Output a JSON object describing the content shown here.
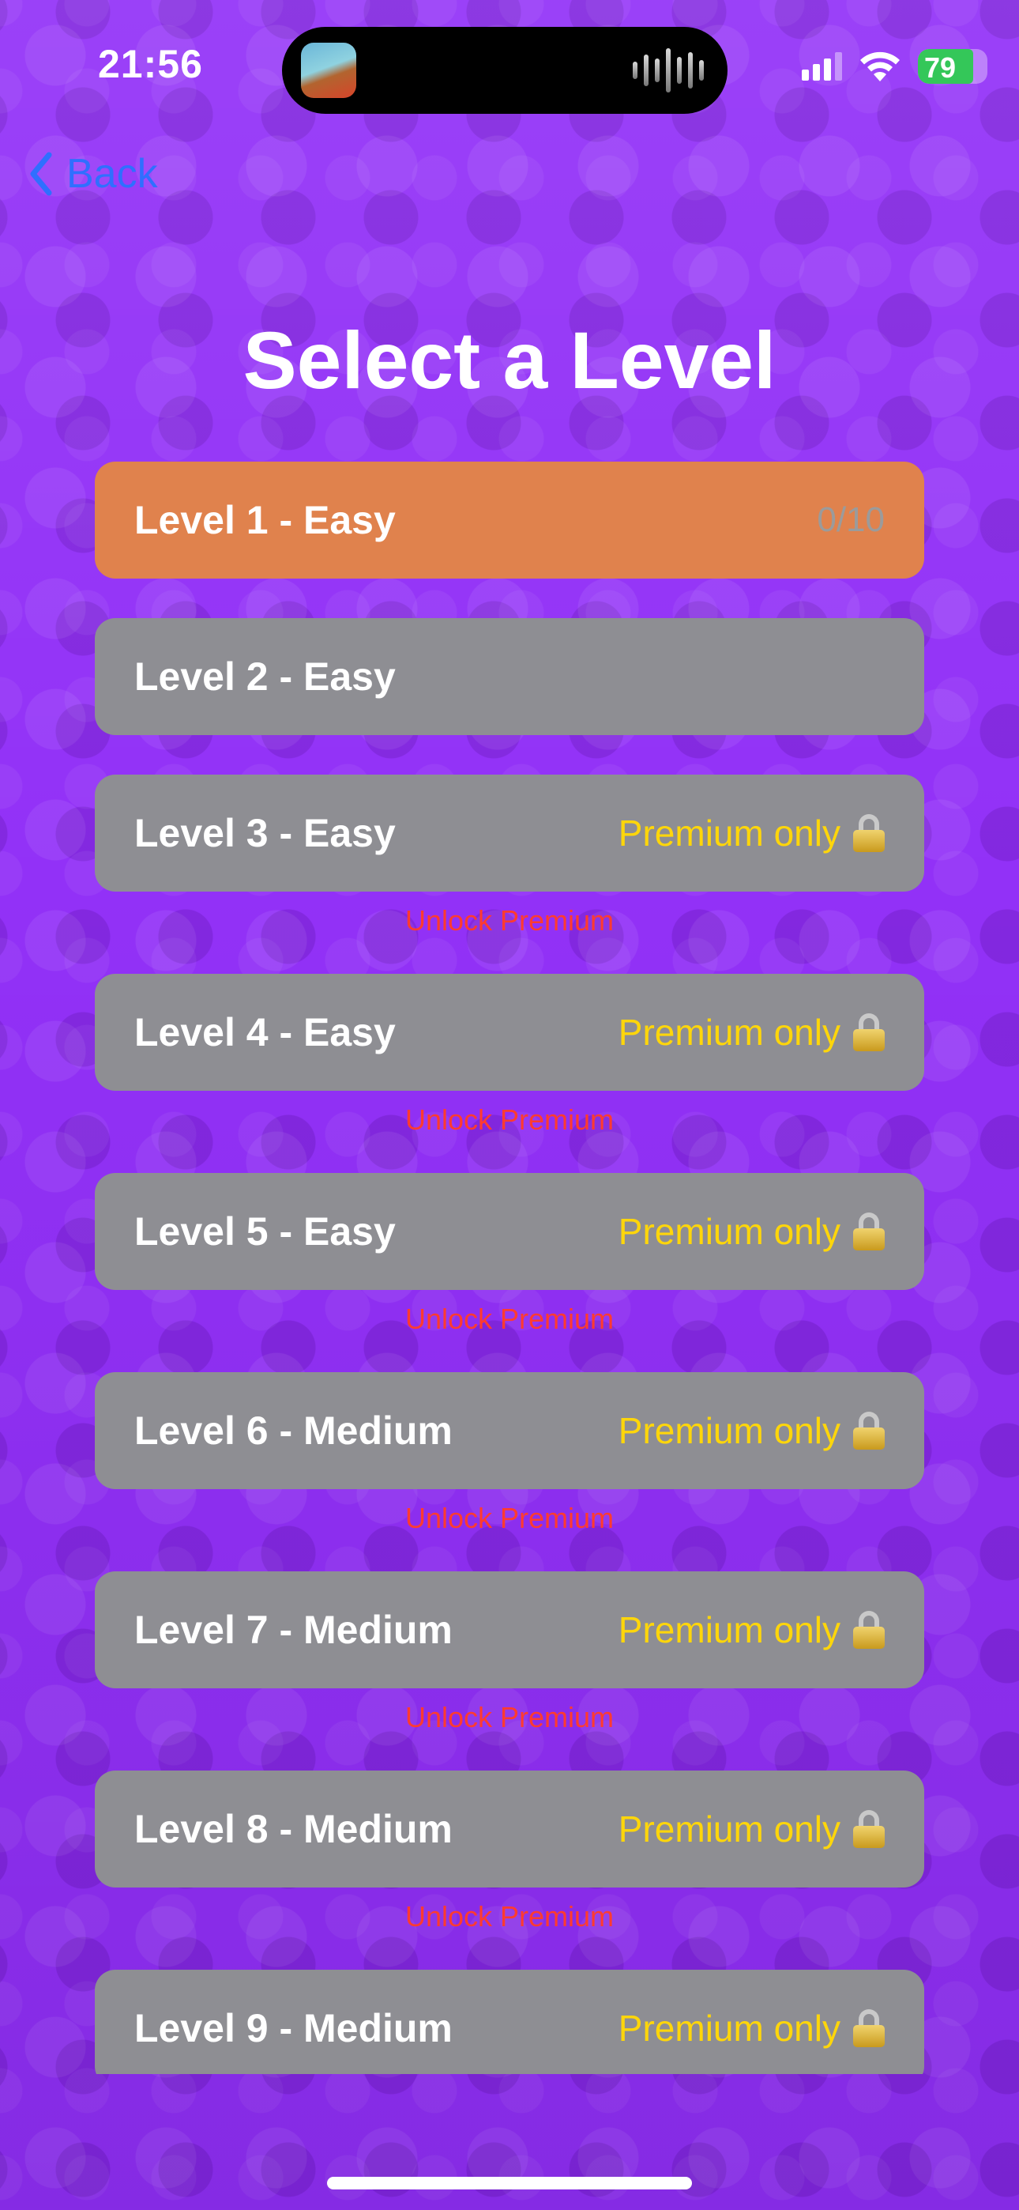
{
  "status_bar": {
    "time": "21:56",
    "battery_level": "79",
    "battery_fraction": 0.79,
    "signal_icon": "cellular-signal-icon",
    "wifi_icon": "wifi-icon",
    "battery_icon": "battery-charging-icon"
  },
  "nav": {
    "back_label": "Back",
    "back_icon": "chevron-left-icon",
    "accent_color": "#2f6fff"
  },
  "page": {
    "title": "Select a Level",
    "background_color": "#9231f7"
  },
  "levels": [
    {
      "name": "Level 1 - Easy",
      "progress": "0/10",
      "state": "active"
    },
    {
      "name": "Level 2 - Easy",
      "state": "unlocked"
    },
    {
      "name": "Level 3 - Easy",
      "status": "Premium only",
      "unlock_label": "Unlock Premium",
      "state": "locked"
    },
    {
      "name": "Level 4 - Easy",
      "status": "Premium only",
      "unlock_label": "Unlock Premium",
      "state": "locked"
    },
    {
      "name": "Level 5 - Easy",
      "status": "Premium only",
      "unlock_label": "Unlock Premium",
      "state": "locked"
    },
    {
      "name": "Level 6 - Medium",
      "status": "Premium only",
      "unlock_label": "Unlock Premium",
      "state": "locked"
    },
    {
      "name": "Level 7 - Medium",
      "status": "Premium only",
      "unlock_label": "Unlock Premium",
      "state": "locked"
    },
    {
      "name": "Level 8 - Medium",
      "status": "Premium only",
      "unlock_label": "Unlock Premium",
      "state": "locked"
    },
    {
      "name": "Level 9 - Medium",
      "status": "Premium only",
      "state": "locked"
    }
  ],
  "colors": {
    "active_row": "#e0824d",
    "inactive_row": "#8e8e93",
    "premium_text": "#ffd60a",
    "unlock_text": "#ff3b30"
  }
}
